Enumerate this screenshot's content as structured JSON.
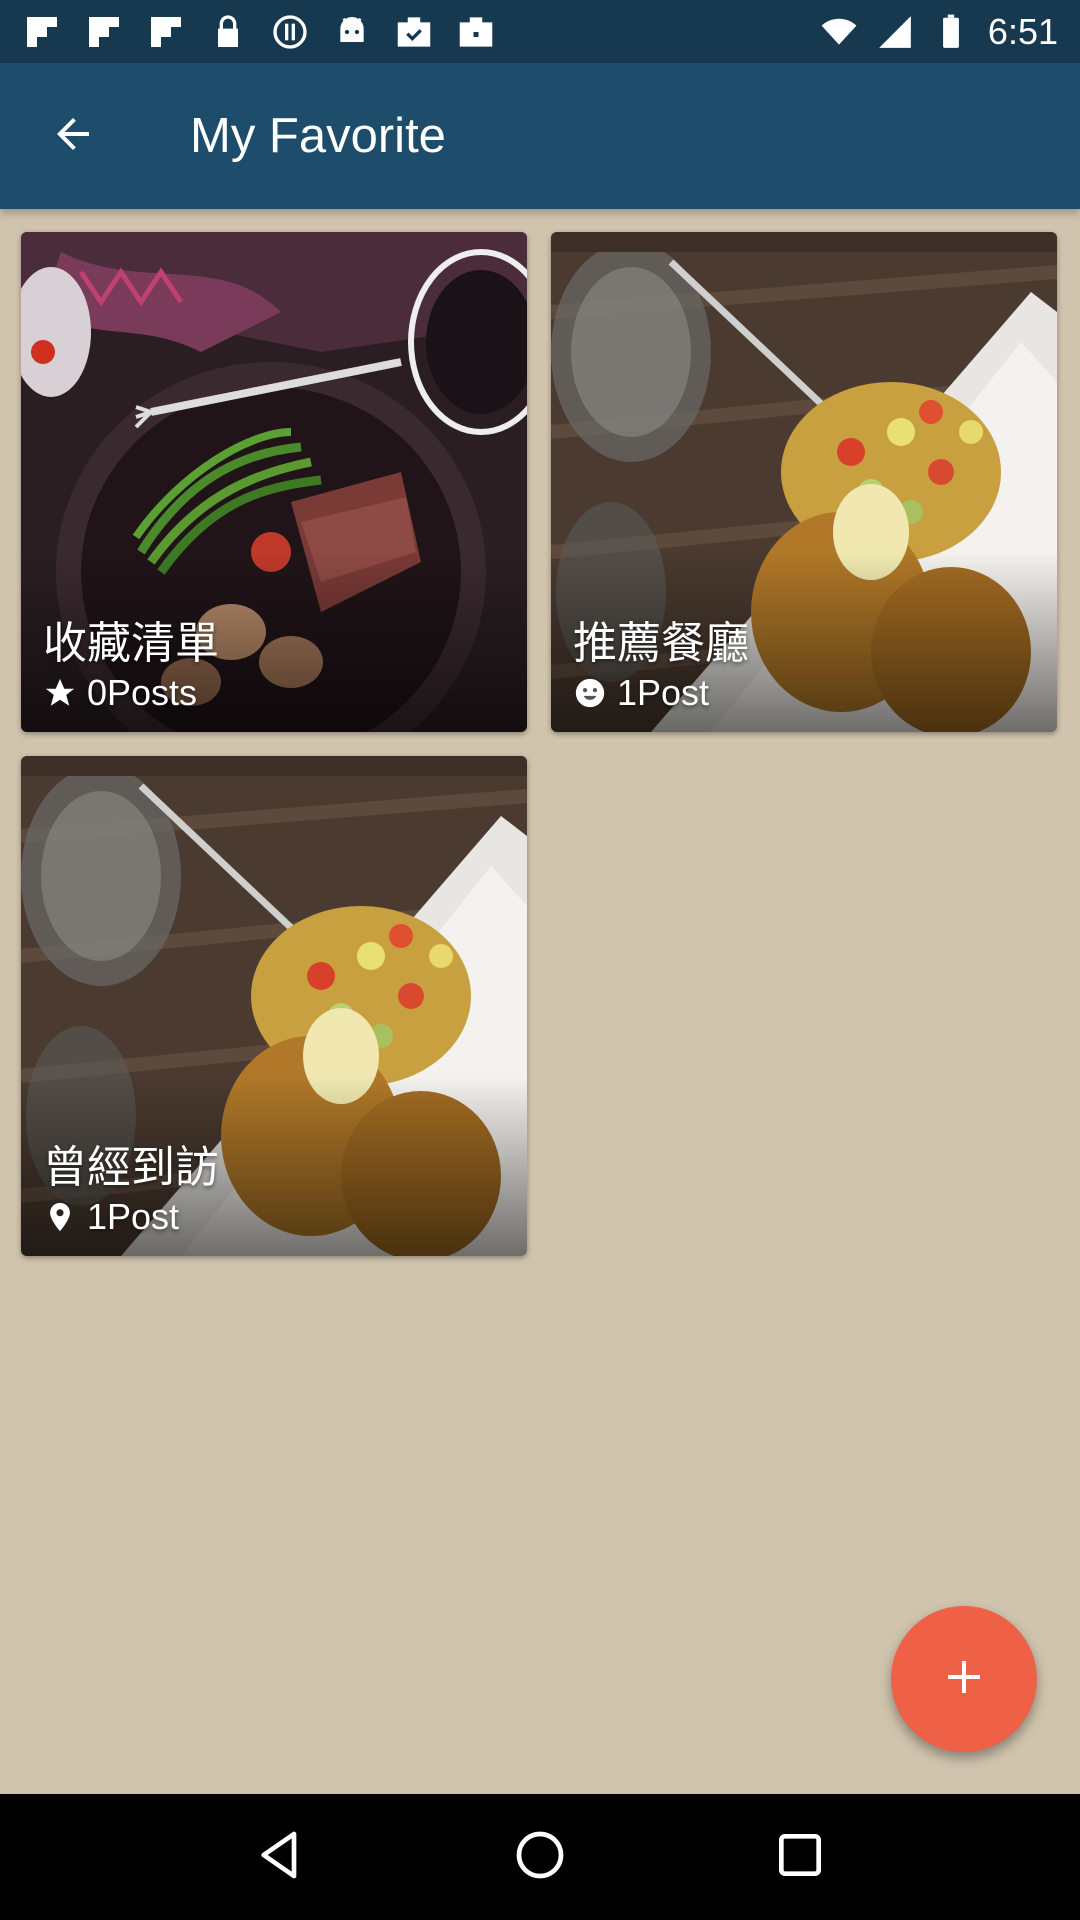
{
  "status_bar": {
    "time": "6:51",
    "icons": [
      "flipboard-icon",
      "flipboard-icon",
      "flipboard-icon",
      "lock-icon",
      "info-circle-icon",
      "android-icon",
      "briefcase-check-icon",
      "briefcase-icon"
    ]
  },
  "app_bar": {
    "title": "My Favorite",
    "back_icon": "arrow-back-icon"
  },
  "cards": [
    {
      "title": "收藏清單",
      "meta": "0Posts",
      "icon": "star-icon"
    },
    {
      "title": "推薦餐廳",
      "meta": "1Post",
      "icon": "smiley-icon"
    },
    {
      "title": "曾經到訪",
      "meta": "1Post",
      "icon": "location-pin-icon"
    }
  ],
  "fab": {
    "icon": "plus-icon",
    "color": "#ee6147"
  },
  "nav_bar": {
    "icons": [
      "back-triangle-icon",
      "home-circle-icon",
      "recents-square-icon"
    ]
  },
  "colors": {
    "app_bar": "#1d4d6b",
    "status_bar": "#16394f",
    "background": "#d1c4ae",
    "accent": "#ee6147"
  }
}
